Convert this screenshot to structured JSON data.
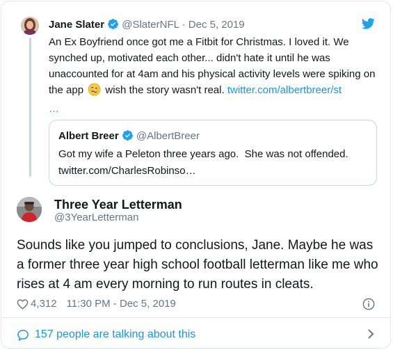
{
  "parent_tweet": {
    "name": "Jane Slater",
    "handle": "@SlaterNFL",
    "separator": "·",
    "date": "Dec 5, 2019",
    "text_before_emoji": "An Ex Boyfriend once got me a Fitbit for Christmas. I loved it. We synched up, motivated each other... didn't hate it until he was unaccounted for at 4am and his physical activity levels were spiking on the app",
    "text_after_emoji": "wish the story wasn't real.",
    "link": "twitter.com/albertbreer/st",
    "link_ellipsis": "…",
    "emoji_icon": "woozy-face-emoji"
  },
  "quoted_tweet": {
    "name": "Albert Breer",
    "handle": "@AlbertBreer",
    "text": "Got my wife a Peleton three years ago.  She was not offended.",
    "link": "twitter.com/CharlesRobinso…"
  },
  "main_tweet": {
    "name": "Three Year Letterman",
    "handle": "@3YearLetterman",
    "text": "Sounds like you jumped to conclusions, Jane. Maybe he was a former three year high school football letterman like me who rises at 4 am every morning to run routes in cleats.",
    "likes": "4,312",
    "timestamp": "11:30 PM - Dec 5, 2019"
  },
  "footer": {
    "talking_label": "157 people are talking about this"
  },
  "colors": {
    "link_blue": "#1b95e0",
    "verified_blue": "#1da1f2",
    "muted_gray": "#657786",
    "border": "#e1e8ed"
  },
  "icons": [
    "verified-badge-icon",
    "twitter-bird-icon",
    "heart-icon",
    "info-icon",
    "speech-bubble-icon",
    "chevron-right-icon"
  ]
}
